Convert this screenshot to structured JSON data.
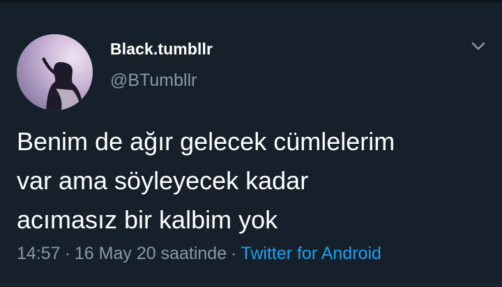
{
  "tweet": {
    "author": {
      "display_name": "Black.tumbllr",
      "handle": "@BTumbllr",
      "avatar_icon": "profile-photo"
    },
    "text": "Benim de ağır gelecek cümlelerim\nvar ama söyleyecek kadar\nacımasız bir kalbim yok",
    "time": "14:57",
    "date_text": "16 May 20 saatinde",
    "separator": "·",
    "source": "Twitter for Android",
    "menu_icon": "chevron-down-icon"
  },
  "colors": {
    "background": "#15202b",
    "primary_text": "#ffffff",
    "secondary_text": "#8899a6",
    "link": "#1da1f2"
  }
}
